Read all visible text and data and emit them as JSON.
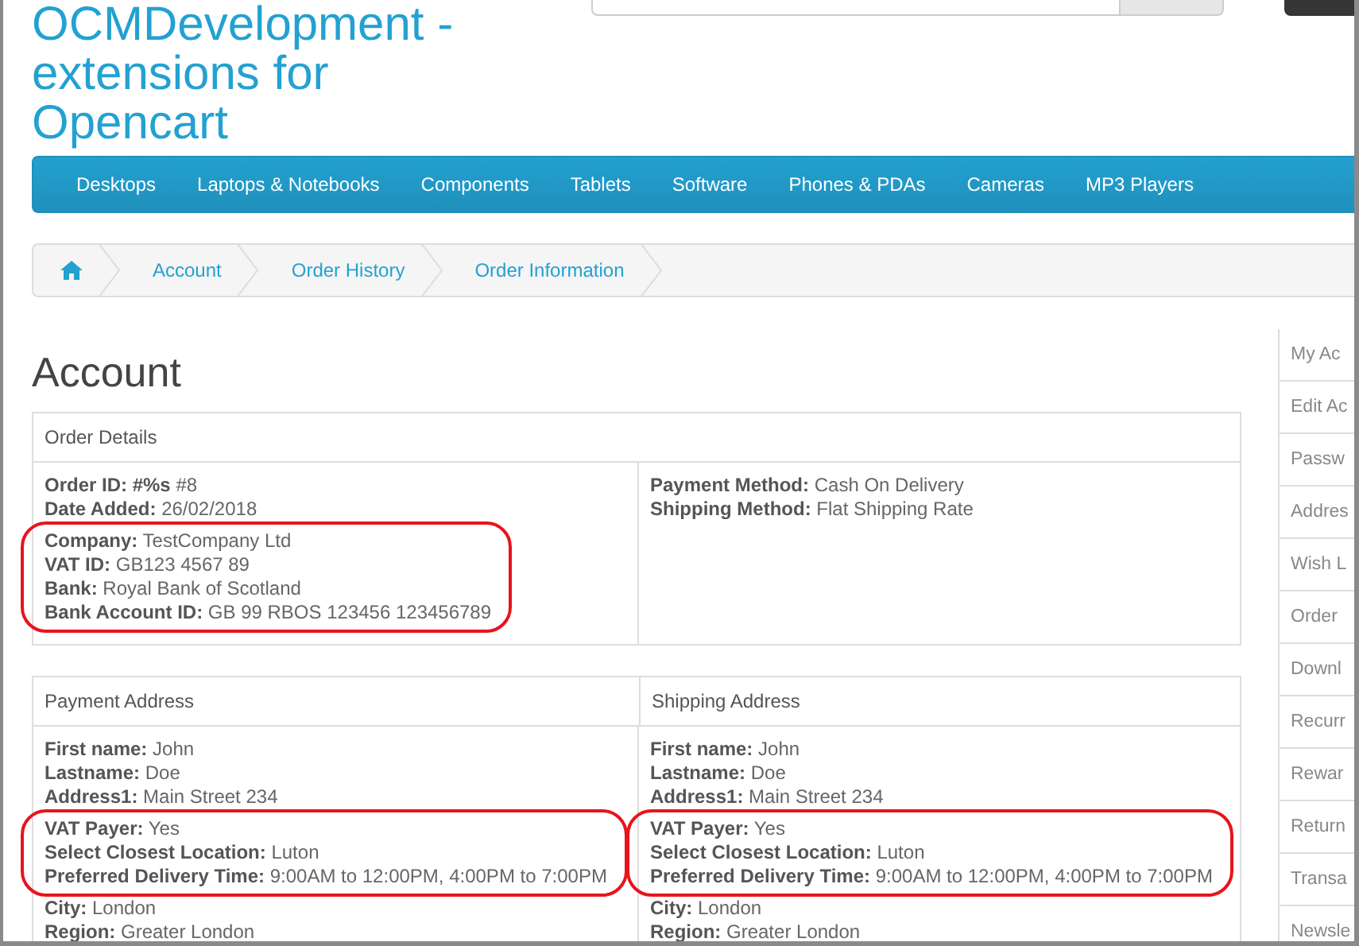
{
  "header": {
    "store_name": "OCMDevelopment - extensions for Opencart"
  },
  "menu": [
    {
      "label": "Desktops"
    },
    {
      "label": "Laptops & Notebooks"
    },
    {
      "label": "Components"
    },
    {
      "label": "Tablets"
    },
    {
      "label": "Software"
    },
    {
      "label": "Phones & PDAs"
    },
    {
      "label": "Cameras"
    },
    {
      "label": "MP3 Players"
    }
  ],
  "breadcrumb": [
    {
      "kind": "home"
    },
    {
      "kind": "link",
      "label": "Account"
    },
    {
      "kind": "link",
      "label": "Order History"
    },
    {
      "kind": "link",
      "label": "Order Information"
    }
  ],
  "page_title": "Account",
  "tables": [
    {
      "headings": [
        "Order Details"
      ],
      "cells": [
        {
          "groups": [
            {
              "circled": false,
              "lines": [
                {
                  "label": "Order ID: #%s",
                  "value": "#8"
                },
                {
                  "label": "Date Added:",
                  "value": "26/02/2018"
                }
              ]
            },
            {
              "circled": true,
              "lines": [
                {
                  "label": "Company:",
                  "value": "TestCompany Ltd"
                },
                {
                  "label": "VAT ID:",
                  "value": "GB123 4567 89"
                },
                {
                  "label": "Bank:",
                  "value": "Royal Bank of Scotland"
                },
                {
                  "label": "Bank Account ID:",
                  "value": "GB 99 RBOS 123456 123456789"
                }
              ]
            }
          ]
        },
        {
          "groups": [
            {
              "circled": false,
              "lines": [
                {
                  "label": "Payment Method:",
                  "value": "Cash On Delivery"
                },
                {
                  "label": "Shipping Method:",
                  "value": "Flat Shipping Rate"
                }
              ]
            }
          ]
        }
      ]
    },
    {
      "headings": [
        "Payment Address",
        "Shipping Address"
      ],
      "cells": [
        {
          "groups": [
            {
              "circled": false,
              "lines": [
                {
                  "label": "First name:",
                  "value": "John"
                },
                {
                  "label": "Lastname:",
                  "value": "Doe"
                },
                {
                  "label": "Address1:",
                  "value": "Main Street 234"
                }
              ]
            },
            {
              "circled": true,
              "lines": [
                {
                  "label": "VAT Payer:",
                  "value": "Yes"
                },
                {
                  "label": "Select Closest Location:",
                  "value": "Luton"
                },
                {
                  "label": "Preferred Delivery Time:",
                  "value": "9:00AM to 12:00PM, 4:00PM to 7:00PM"
                }
              ]
            },
            {
              "circled": false,
              "lines": [
                {
                  "label": "City:",
                  "value": "London"
                },
                {
                  "label": "Region:",
                  "value": "Greater London"
                }
              ]
            }
          ]
        },
        {
          "groups": [
            {
              "circled": false,
              "lines": [
                {
                  "label": "First name:",
                  "value": "John"
                },
                {
                  "label": "Lastname:",
                  "value": "Doe"
                },
                {
                  "label": "Address1:",
                  "value": "Main Street 234"
                }
              ]
            },
            {
              "circled": true,
              "lines": [
                {
                  "label": "VAT Payer:",
                  "value": "Yes"
                },
                {
                  "label": "Select Closest Location:",
                  "value": "Luton"
                },
                {
                  "label": "Preferred Delivery Time:",
                  "value": "9:00AM to 12:00PM, 4:00PM to 7:00PM"
                }
              ]
            },
            {
              "circled": false,
              "lines": [
                {
                  "label": "City:",
                  "value": "London"
                },
                {
                  "label": "Region:",
                  "value": "Greater London"
                }
              ]
            }
          ]
        }
      ]
    }
  ],
  "account_menu": [
    "My Ac",
    "Edit Ac",
    "Passw",
    "Addres",
    "Wish L",
    "Order",
    "Downl",
    "Recurr",
    "Rewar",
    "Return",
    "Transa",
    "Newsle"
  ]
}
